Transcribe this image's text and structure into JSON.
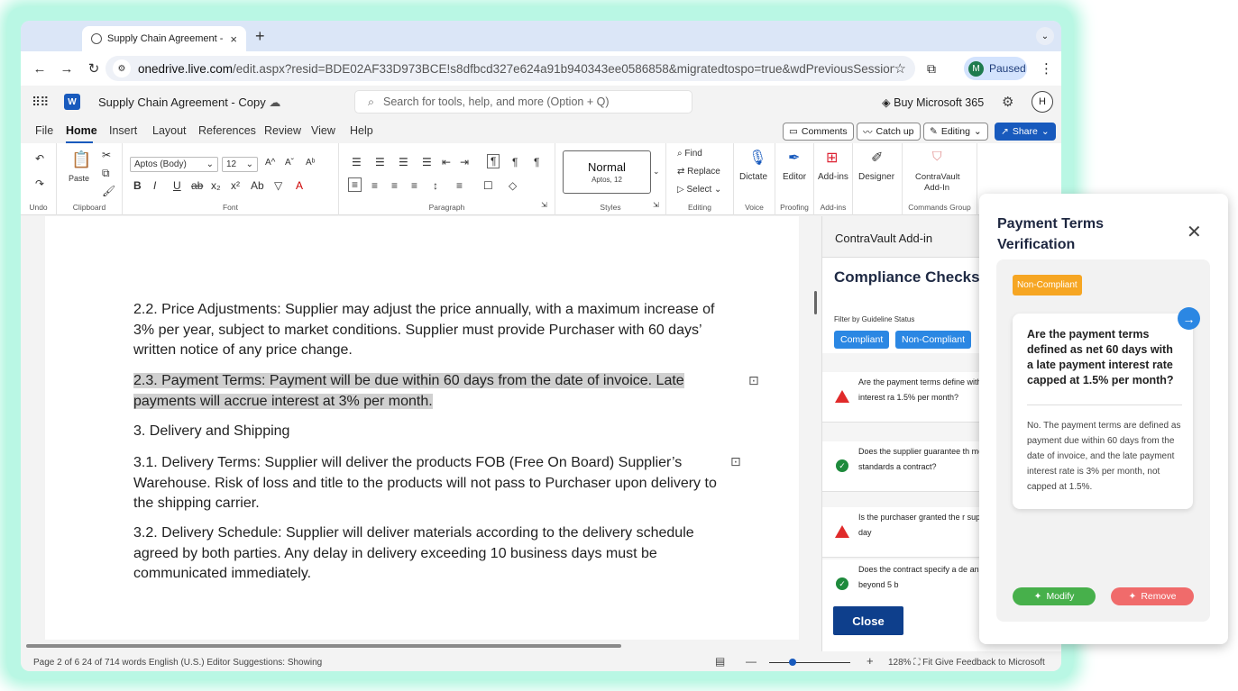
{
  "browser": {
    "tab_title": "Supply Chain Agreement - Copy",
    "tab_close": "×",
    "new_tab": "+",
    "url_host": "onedrive.live.com",
    "url_path": "/edit.aspx?resid=BDE02AF33D973BCE!s8dfbcd327e624a91b940343ee0586858&migratedtospo=true&wdPreviousSession=3b331ba1-f7...",
    "profile_initial": "M",
    "profile_status": "Paused"
  },
  "word": {
    "doc_title": "Supply Chain Agreement - Copy",
    "search_placeholder": "Search for tools, help, and more (Option + Q)",
    "buy_label": "Buy Microsoft 365",
    "user_initial": "H",
    "menu": [
      "File",
      "Home",
      "Insert",
      "Layout",
      "References",
      "Review",
      "View",
      "Help"
    ],
    "comments_label": "Comments",
    "catchup_label": "Catch up",
    "editing_label": "Editing",
    "share_label": "Share"
  },
  "ribbon": {
    "undo_label": "Undo",
    "paste_label": "Paste",
    "clipboard_label": "Clipboard",
    "font_name": "Aptos (Body)",
    "font_size": "12",
    "font_label": "Font",
    "paragraph_label": "Paragraph",
    "style_name": "Normal",
    "style_sub": "Aptos, 12",
    "styles_label": "Styles",
    "find_label": "Find",
    "replace_label": "Replace",
    "select_label": "Select",
    "editing_group_label": "Editing",
    "dictate_label": "Dictate",
    "voice_label": "Voice",
    "editor_label": "Editor",
    "proofing_label": "Proofing",
    "addins_label": "Add-ins",
    "addins_group_label": "Add-ins",
    "designer_label": "Designer",
    "contravault_label_1": "ContraVault",
    "contravault_label_2": "Add-In",
    "commands_group_label": "Commands Group"
  },
  "document": {
    "p1": " 2.2. Price Adjustments: Supplier may adjust the price annually, with a maximum increase of 3% per year, subject to market conditions. Supplier must provide Purchaser with 60 days’ written notice of any price change.",
    "p2": " 2.3. Payment Terms: Payment will be due within 60 days from the date of invoice. Late payments will accrue interest at 3% per month. ",
    "p3": " 3. Delivery and Shipping",
    "p4": "3.1. Delivery Terms: Supplier will deliver the products FOB (Free On Board) Supplier’s Warehouse. Risk of loss and title to the products will not pass to Purchaser upon delivery to the shipping carrier.",
    "p5": " 3.2. Delivery Schedule: Supplier will deliver materials according to the delivery schedule agreed by both parties. Any delay in delivery exceeding 10 business days must be communicated immediately."
  },
  "sidepanel": {
    "header": "ContraVault Add-in",
    "title": "Compliance Checks",
    "filter_label": "Filter by Guideline Status",
    "pill_compliant": "Compliant",
    "pill_noncompliant": "Non-Compliant",
    "items": [
      {
        "status": "non-compliant",
        "text": "Are the payment terms define with a late payment interest ra 1.5% per month?"
      },
      {
        "status": "compliant",
        "text": "Does the supplier guarantee th meet GMP and ISO standards a contract?"
      },
      {
        "status": "non-compliant",
        "text": "Is the purchaser granted the r supplier's facilities with 30 day"
      },
      {
        "status": "compliant",
        "text": "Does the contract specify a de and are any delays beyond 5 b"
      }
    ],
    "close_label": "Close"
  },
  "popup": {
    "title": "Payment Terms Verification",
    "status_badge": "Non-Compliant",
    "question": "Are the payment terms defined as net 60 days with a late payment interest rate capped at 1.5% per month?",
    "answer": "No. The payment terms are defined as payment due within 60 days from the date of invoice, and the late payment interest rate is 3% per month, not capped at 1.5%.",
    "modify_label": "Modify",
    "remove_label": "Remove"
  },
  "statusbar": {
    "left": "Page 2 of 6   24 of 714 words   English (U.S.)   Editor Suggestions: Showing",
    "right": "128%  ⛶ Fit   Give Feedback to Microsoft"
  },
  "colors": {
    "word_blue": "#185abd",
    "panel_blue": "#2b87e3",
    "badge_orange": "#f6a623",
    "modify_green": "#47b04b",
    "remove_red": "#f06b6b",
    "close_navy": "#0e3f8c"
  }
}
